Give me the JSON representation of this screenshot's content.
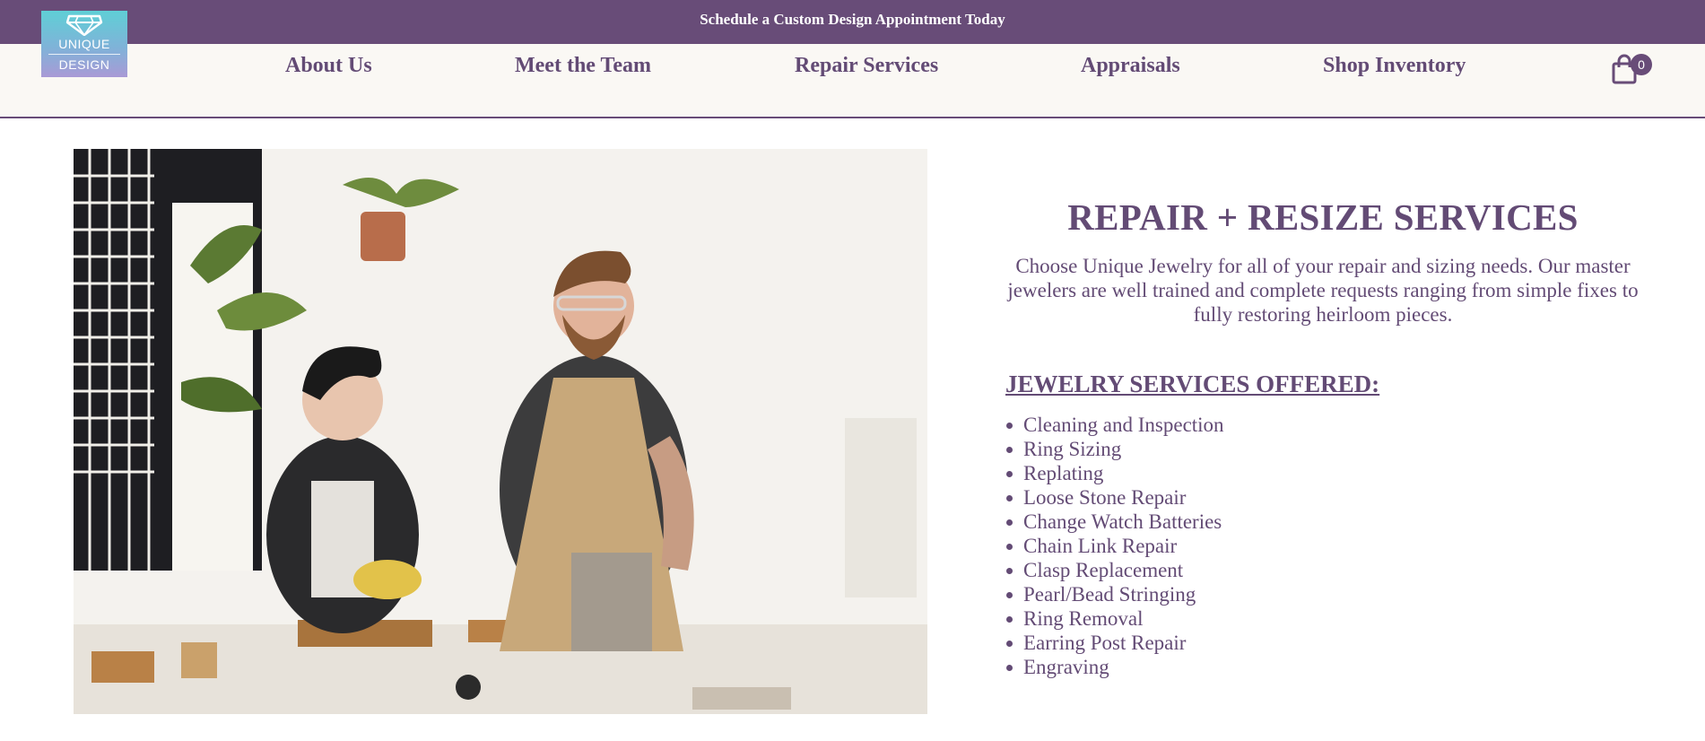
{
  "banner": {
    "text": "Schedule a Custom Design Appointment Today"
  },
  "logo": {
    "line1": "UNIQUE",
    "line2": "DESIGN"
  },
  "nav": [
    {
      "label": "About Us"
    },
    {
      "label": "Meet the Team"
    },
    {
      "label": "Repair Services"
    },
    {
      "label": "Appraisals"
    },
    {
      "label": "Shop Inventory"
    }
  ],
  "cart": {
    "count": "0",
    "icon": "shopping-bag-icon"
  },
  "hero": {
    "image": "jewelers-workshop-photo"
  },
  "main": {
    "title": "REPAIR + RESIZE SERVICES",
    "intro": "Choose Unique Jewelry for all of your repair and sizing needs. Our master jewelers are well trained and complete requests ranging from simple fixes to fully restoring heirloom pieces.",
    "services_heading": "JEWELRY SERVICES OFFERED:",
    "services": [
      "Cleaning and Inspection",
      "Ring Sizing",
      "Replating",
      "Loose Stone Repair",
      "Change Watch Batteries",
      "Chain Link Repair",
      "Clasp Replacement",
      "Pearl/Bead Stringing",
      "Ring Removal",
      "Earring Post Repair",
      "Engraving"
    ]
  },
  "colors": {
    "brand": "#684c78",
    "text": "#634b75",
    "header_bg": "#faf8f4"
  }
}
